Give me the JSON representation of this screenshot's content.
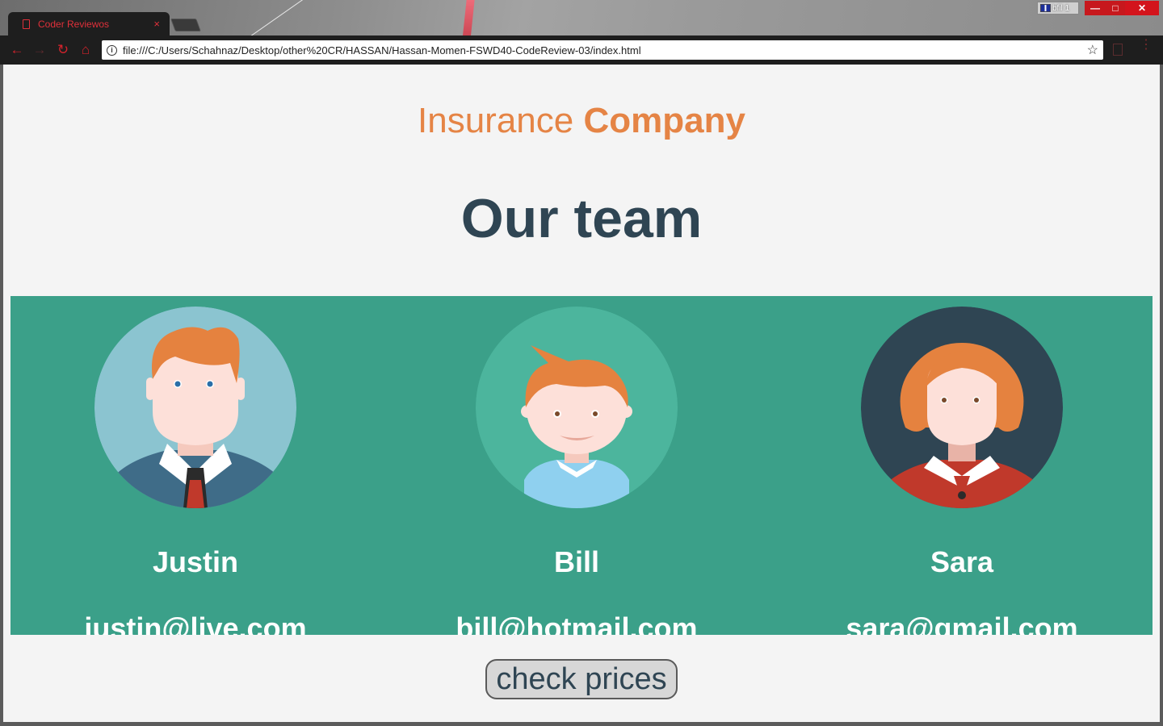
{
  "browser": {
    "tab_title": "Coder Reviewos",
    "tab_close": "×",
    "profile_label": "bfil 1",
    "url": "file:///C:/Users/Schahnaz/Desktop/other%20CR/HASSAN/Hassan-Momen-FSWD40-CodeReview-03/index.html",
    "icons": {
      "back": "arrow-left-icon",
      "forward": "arrow-right-icon",
      "reload": "reload-icon",
      "home": "home-icon",
      "info": "info-icon",
      "star": "star-icon",
      "menu": "menu-dots-icon"
    },
    "accent_color": "#d3232c"
  },
  "page": {
    "brand_light": "Insurance",
    "brand_bold": "Company",
    "heading": "Our team",
    "members": [
      {
        "name": "Justin",
        "email": "justin@live.com",
        "avatar": "man-with-tie-avatar"
      },
      {
        "name": "Bill",
        "email": "bill@hotmail.com",
        "avatar": "boy-avatar"
      },
      {
        "name": "Sara",
        "email": "sara@gmail.com",
        "avatar": "woman-avatar"
      }
    ],
    "cta_label": "check prices",
    "colors": {
      "brand": "#e58445",
      "heading": "#2f4553",
      "band": "#3ba089",
      "background": "#f4f4f4"
    }
  }
}
